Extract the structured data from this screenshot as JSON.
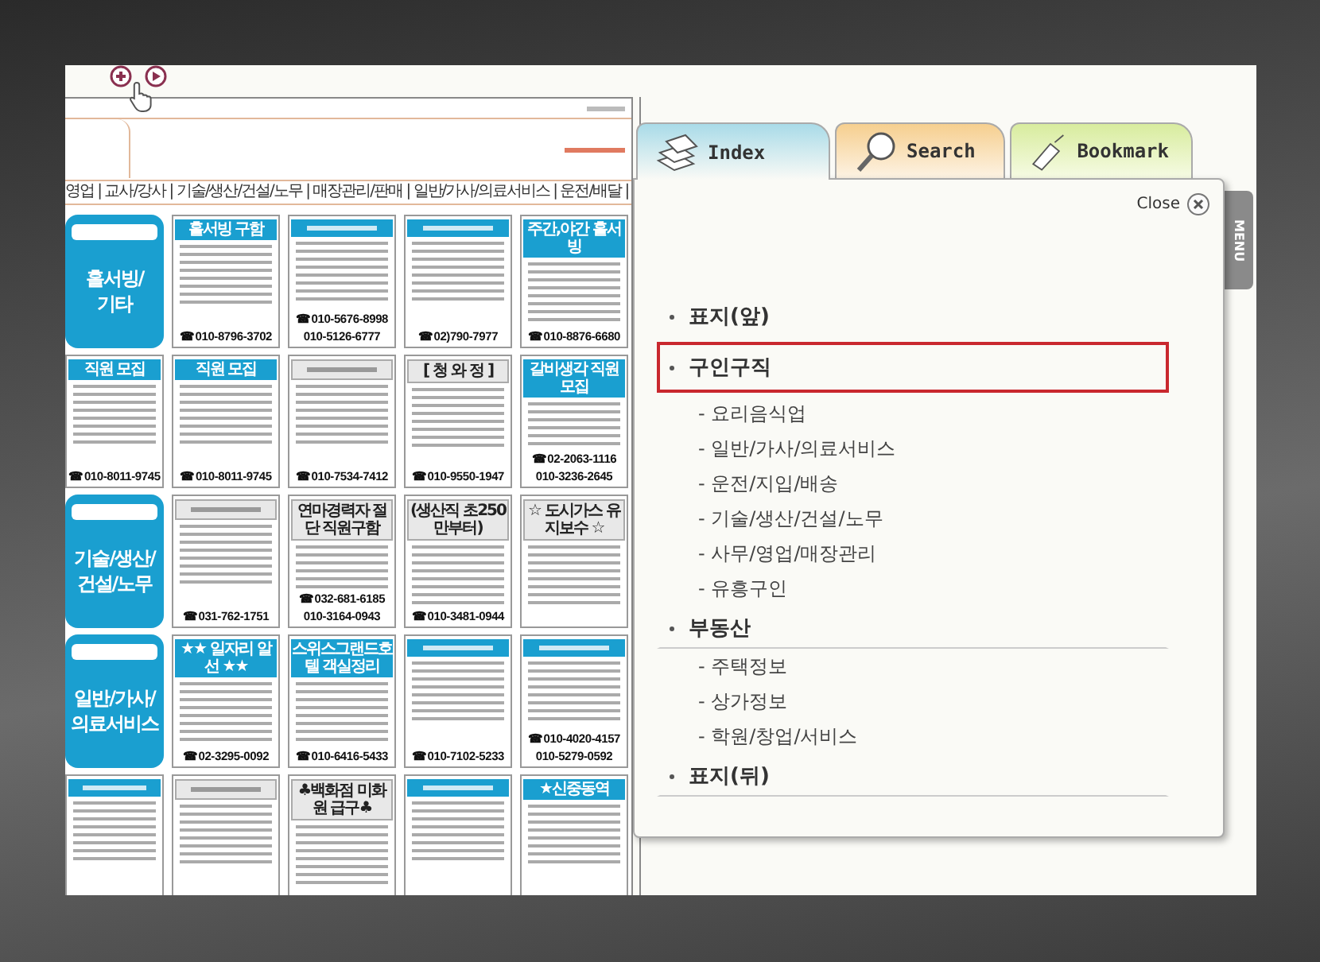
{
  "page": {
    "nav": "영업 | 교사/강사 | 기술/생산/건설/노무 | 매장관리/판매 | 일반/가사/의료서비스 | 운전/배달 |",
    "rows": [
      {
        "cells": [
          {
            "kind": "category",
            "label": "홀서빙/기타"
          },
          {
            "kind": "ad",
            "filled_header": true,
            "header": "홀서빙 구함",
            "phones": [
              "☎010-8796-3702"
            ]
          },
          {
            "kind": "ad",
            "filled_header": true,
            "phones": [
              "☎010-5676-8998",
              "010-5126-6777"
            ]
          },
          {
            "kind": "ad",
            "filled_header": true,
            "phones": [
              "☎02)790-7977"
            ]
          },
          {
            "kind": "ad",
            "filled_header": true,
            "header": "주간,야간 홀서빙",
            "phones": [
              "☎010-8876-6680"
            ]
          }
        ]
      },
      {
        "cells": [
          {
            "kind": "ad",
            "filled_header": true,
            "header": "직원 모집",
            "phones": [
              "☎010-8011-9745"
            ]
          },
          {
            "kind": "ad",
            "filled_header": true,
            "header": "직원 모집",
            "phones": [
              "☎010-8011-9745"
            ]
          },
          {
            "kind": "ad",
            "filled_header": false,
            "phones": [
              "☎010-7534-7412"
            ]
          },
          {
            "kind": "ad",
            "filled_header": false,
            "header": "[ 청 와 정 ]",
            "phones": [
              "☎010-9550-1947"
            ]
          },
          {
            "kind": "ad",
            "filled_header": true,
            "header": "갈비생각 직원 모집",
            "phones": [
              "☎02-2063-1116",
              "010-3236-2645"
            ]
          }
        ]
      },
      {
        "cells": [
          {
            "kind": "category",
            "label": "기술/생산/건설/노무"
          },
          {
            "kind": "ad",
            "filled_header": false,
            "phones": [
              "☎031-762-1751"
            ]
          },
          {
            "kind": "ad",
            "filled_header": false,
            "header": "연마경력자 절단 직원구함",
            "phones": [
              "☎032-681-6185",
              "010-3164-0943"
            ]
          },
          {
            "kind": "ad",
            "filled_header": false,
            "header": "(생산직 초250만부터)",
            "phones": [
              "☎010-3481-0944"
            ]
          },
          {
            "kind": "ad",
            "filled_header": false,
            "header": "☆ 도시가스 유지보수 ☆"
          }
        ]
      },
      {
        "cells": [
          {
            "kind": "category",
            "label": "일반/가사/의료서비스"
          },
          {
            "kind": "ad",
            "filled_header": true,
            "header": "★★ 일자리 알선 ★★",
            "phones": [
              "☎02-3295-0092"
            ]
          },
          {
            "kind": "ad",
            "filled_header": true,
            "header": "스위스그랜드호텔 객실정리",
            "phones": [
              "☎010-6416-5433"
            ]
          },
          {
            "kind": "ad",
            "filled_header": true,
            "phones": [
              "☎010-7102-5233"
            ]
          },
          {
            "kind": "ad",
            "filled_header": true,
            "phones": [
              "☎010-4020-4157",
              "010-5279-0592"
            ]
          }
        ]
      },
      {
        "cells": [
          {
            "kind": "ad",
            "filled_header": true
          },
          {
            "kind": "ad",
            "filled_header": false
          },
          {
            "kind": "ad",
            "filled_header": false,
            "header": "♣백화점 미화원 급구♣"
          },
          {
            "kind": "ad",
            "filled_header": true
          },
          {
            "kind": "ad",
            "filled_header": true,
            "header": "★신중동역"
          }
        ]
      }
    ]
  },
  "index_panel": {
    "tabs": [
      {
        "label": "Index",
        "kind": "index",
        "selected": true
      },
      {
        "label": "Search",
        "kind": "search",
        "selected": false
      },
      {
        "label": "Bookmark",
        "kind": "bookmark",
        "selected": false
      }
    ],
    "close": "Close",
    "entries": [
      {
        "label": "표지(앞)",
        "selected": false,
        "underlined": false
      },
      {
        "label": "구인구직",
        "selected": true,
        "underlined": false,
        "children": [
          "- 요리음식업",
          "- 일반/가사/의료서비스",
          "- 운전/지입/배송",
          "- 기술/생산/건설/노무",
          "- 사무/영업/매장관리",
          "- 유흥구인"
        ]
      },
      {
        "label": "부동산",
        "selected": false,
        "underlined": true,
        "children": [
          "- 주택정보",
          "- 상가정보",
          "- 학원/창업/서비스"
        ]
      },
      {
        "label": "표지(뒤)",
        "selected": false,
        "underlined": true
      }
    ]
  },
  "side_tab": "MENU"
}
